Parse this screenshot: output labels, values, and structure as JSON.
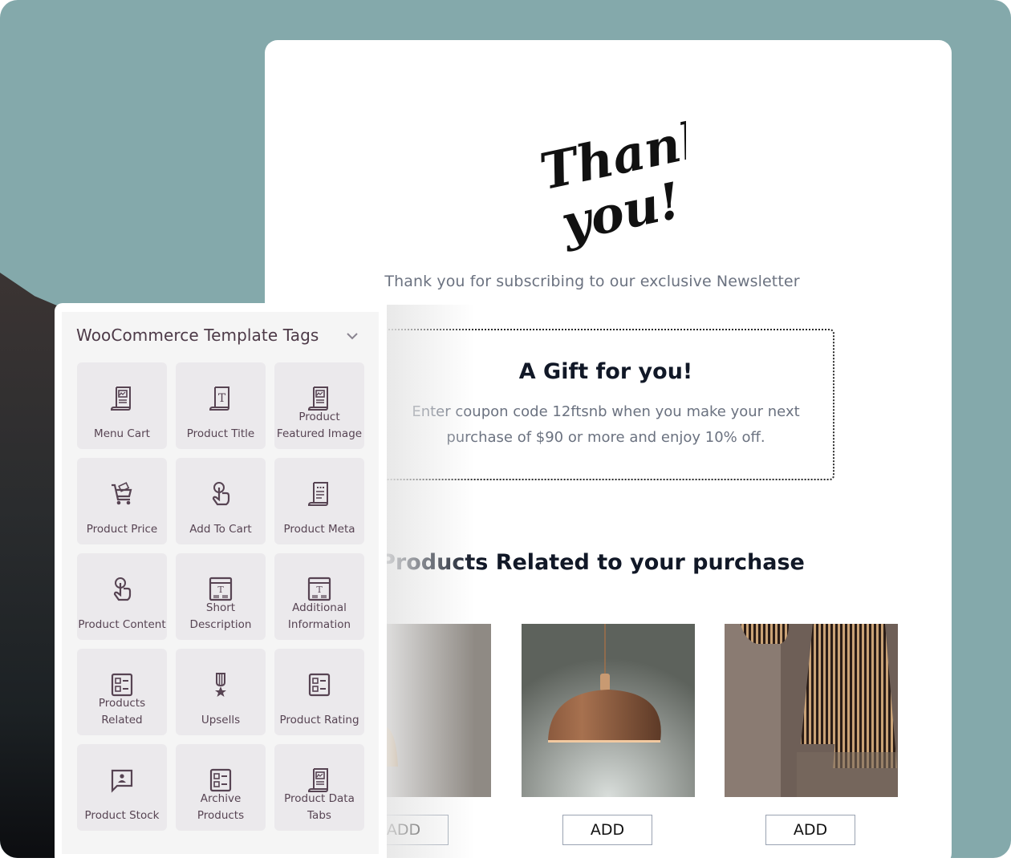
{
  "email": {
    "logo_text": [
      "Thank",
      "you!"
    ],
    "subtitle": "Thank you for subscribing to our exclusive Newsletter",
    "gift": {
      "title": "A Gift for you!",
      "text": "Enter coupon code 12ftsnb when you make your next purchase of $90 or more and enjoy 10% off."
    },
    "related_title": "Products Related to your purchase",
    "products": [
      {
        "image": "copper-pendant-lamps-cluster",
        "button": "ADD"
      },
      {
        "image": "copper-dome-pendant-lamp",
        "button": "ADD"
      },
      {
        "image": "wooden-slat-pendant-lamps",
        "button": "ADD"
      }
    ]
  },
  "panel": {
    "title": "WooCommerce Template Tags",
    "tiles": [
      {
        "label": "Menu Cart",
        "icon": "document-chart-icon"
      },
      {
        "label": "Product Title",
        "icon": "document-title-icon"
      },
      {
        "label": "Product\nFeatured Image",
        "icon": "document-chart-icon"
      },
      {
        "label": "Product Price",
        "icon": "cart-icon"
      },
      {
        "label": "Add To Cart",
        "icon": "tap-icon"
      },
      {
        "label": "Product Meta",
        "icon": "document-lines-icon"
      },
      {
        "label": "Product Content",
        "icon": "tap-icon"
      },
      {
        "label": "Short\nDescription",
        "icon": "window-title-icon"
      },
      {
        "label": "Additional\nInformation",
        "icon": "window-title-icon"
      },
      {
        "label": "Products\nRelated",
        "icon": "list-grid-icon"
      },
      {
        "label": "Upsells",
        "icon": "medal-icon"
      },
      {
        "label": "Product Rating",
        "icon": "list-grid-icon"
      },
      {
        "label": "Product Stock",
        "icon": "chat-user-icon"
      },
      {
        "label": "Archive\nProducts",
        "icon": "list-grid-icon"
      },
      {
        "label": "Product Data\nTabs",
        "icon": "document-chart-icon"
      }
    ]
  },
  "colors": {
    "background": "#84a9ab",
    "icon": "#574453",
    "tile": "#ebe9ec",
    "heading": "#111827",
    "muted": "#6b7280"
  }
}
